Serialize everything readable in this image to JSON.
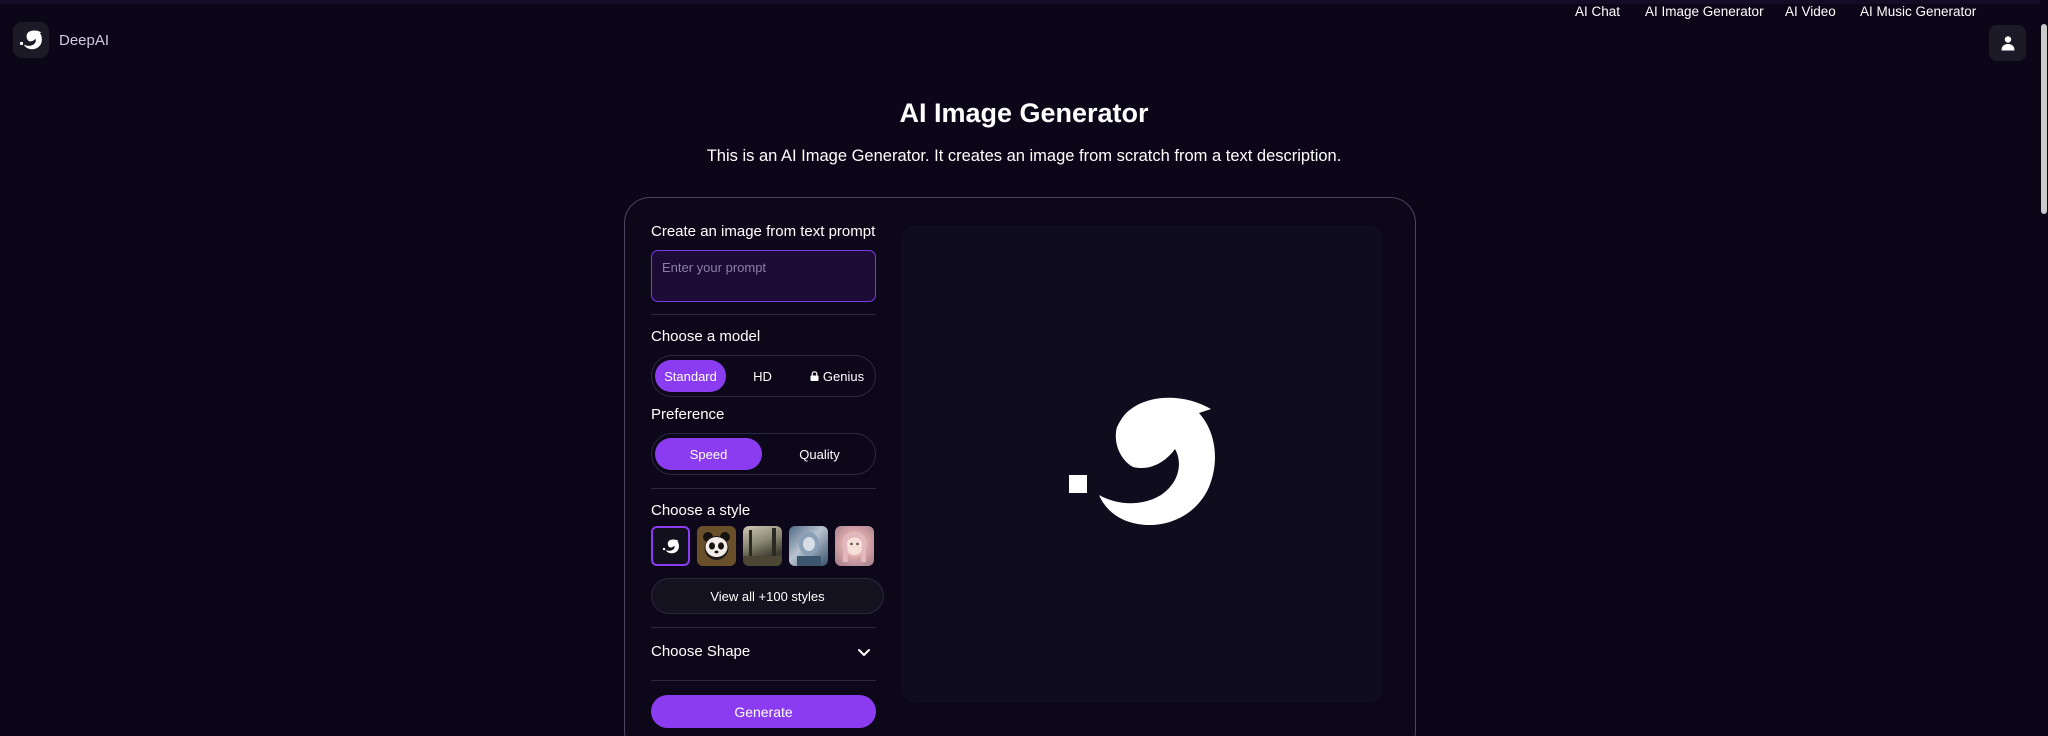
{
  "header": {
    "brand": "DeepAI",
    "nav": [
      {
        "label": "AI Chat"
      },
      {
        "label": "AI Image Generator"
      },
      {
        "label": "AI Video"
      },
      {
        "label": "AI Music Generator"
      }
    ]
  },
  "page": {
    "title": "AI Image Generator",
    "subtitle": "This is an AI Image Generator. It creates an image from scratch from a text description."
  },
  "form": {
    "prompt_label": "Create an image from text prompt",
    "prompt_placeholder": "Enter your prompt",
    "prompt_value": "",
    "model_label": "Choose a model",
    "models": [
      "Standard",
      "HD",
      "Genius"
    ],
    "selected_model": "Standard",
    "preference_label": "Preference",
    "preferences": [
      "Speed",
      "Quality"
    ],
    "selected_preference": "Speed",
    "style_label": "Choose a style",
    "view_all_styles": "View all +100 styles",
    "shape_label": "Choose Shape",
    "generate_label": "Generate"
  },
  "icons": {
    "brand_logo": "deepai-dolphin-logo-icon",
    "user": "user-icon",
    "lock": "lock-icon",
    "chevron": "chevron-down-icon",
    "preview_placeholder": "deepai-dolphin-logo-icon"
  },
  "colors": {
    "background": "#0b0618",
    "accent": "#8b3cf0",
    "card_border": "#4a4560",
    "preview_bg": "#0f0c1e"
  }
}
